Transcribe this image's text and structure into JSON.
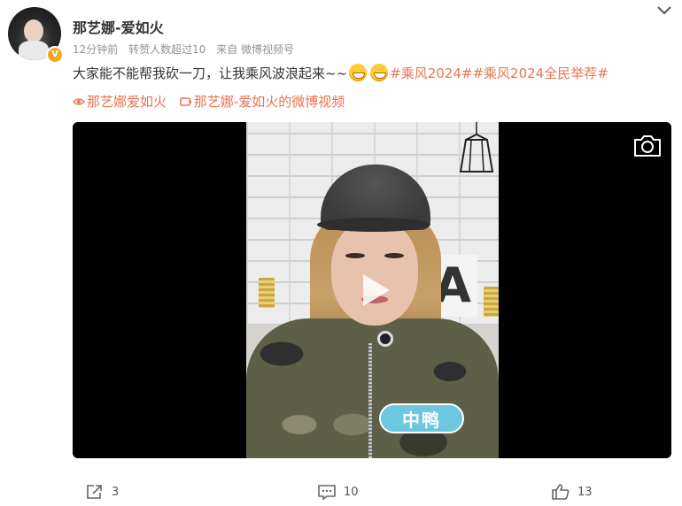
{
  "author": {
    "name": "那艺娜-爱如火",
    "verified": true
  },
  "meta": {
    "time": "12分钟前",
    "reposts_note": "转赞人数超过10",
    "source": "来自 微博视频号"
  },
  "post": {
    "text": "大家能不能帮我砍一刀，让我乘风波浪起来~~",
    "emoji_count": 2,
    "hashtags": "#乘风2024##乘风2024全民举荐#"
  },
  "links": {
    "super_topic": "那艺娜爱如火",
    "video_link": "那艺娜-爱如火的微博视频"
  },
  "video": {
    "watermark": "中鸭"
  },
  "actions": {
    "repost_count": "3",
    "comment_count": "10",
    "like_count": "13"
  },
  "icons": {
    "menu": "chevron-down-icon",
    "screenshot": "camera-icon",
    "play": "play-icon",
    "repost": "share-icon",
    "comment": "comment-icon",
    "like": "thumbs-up-icon"
  },
  "colors": {
    "accent": "#eb7350",
    "meta": "#939393",
    "badge": "#f5a623"
  }
}
